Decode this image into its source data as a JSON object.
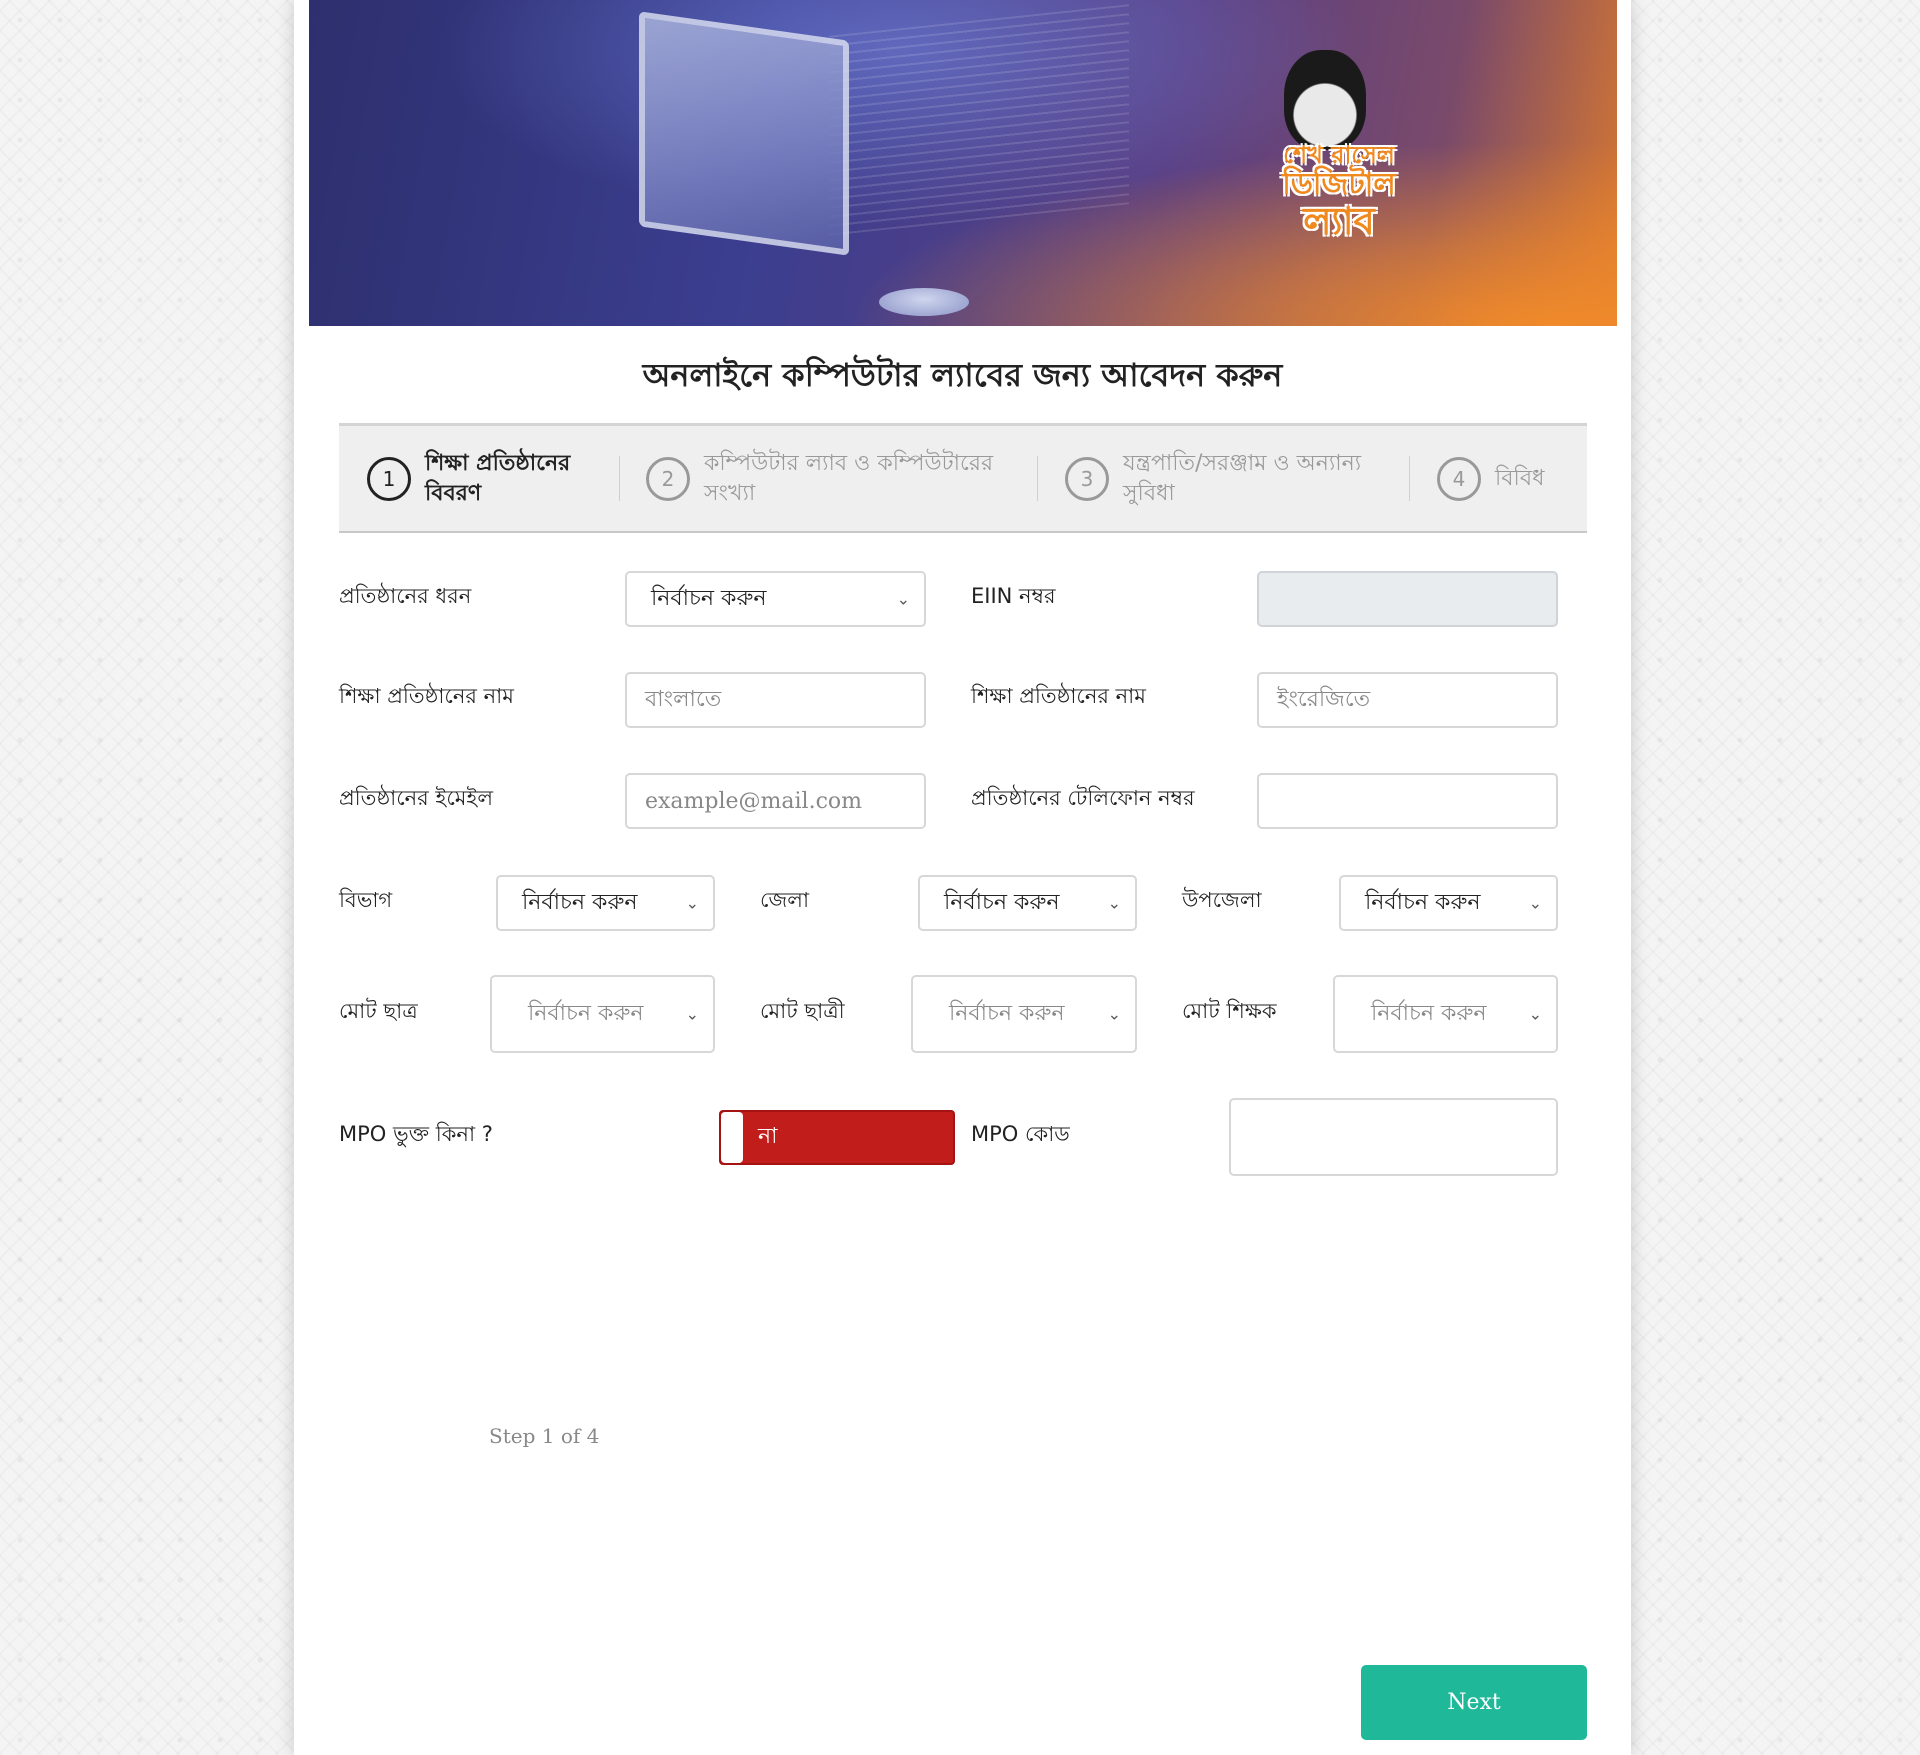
{
  "banner": {
    "logo_line1": "শেখ রাসেল",
    "logo_line2": "ডিজিটাল",
    "logo_line3": "ল্যাব"
  },
  "page_title": "অনলাইনে কম্পিউটার ল্যাবের জন্য আবেদন করুন",
  "steps": [
    {
      "number": "1",
      "label": "শিক্ষা প্রতিষ্ঠানের বিবরণ",
      "active": true
    },
    {
      "number": "2",
      "label": "কম্পিউটার ল্যাব ও কম্পিউটারের সংখ্যা",
      "active": false
    },
    {
      "number": "3",
      "label": "যন্ত্রপাতি/সরঞ্জাম ও অন্যান্য সুবিধা",
      "active": false
    },
    {
      "number": "4",
      "label": "বিবিধ",
      "active": false
    }
  ],
  "form": {
    "institution_type": {
      "label": "প্রতিষ্ঠানের ধরন",
      "value": "নির্বাচন করুন"
    },
    "eiin": {
      "label": "EIIN নম্বর",
      "value": ""
    },
    "name_bn": {
      "label": "শিক্ষা প্রতিষ্ঠানের নাম",
      "placeholder": "বাংলাতে"
    },
    "name_en": {
      "label": "শিক্ষা প্রতিষ্ঠানের নাম",
      "placeholder": "ইংরেজিতে"
    },
    "email": {
      "label": "প্রতিষ্ঠানের ইমেইল",
      "placeholder": "example@mail.com"
    },
    "phone": {
      "label": "প্রতিষ্ঠানের টেলিফোন নম্বর",
      "value": ""
    },
    "division": {
      "label": "বিভাগ",
      "value": "নির্বাচন করুন"
    },
    "district": {
      "label": "জেলা",
      "value": "নির্বাচন করুন"
    },
    "upazila": {
      "label": "উপজেলা",
      "value": "নির্বাচন করুন"
    },
    "total_male_students": {
      "label": "মোট ছাত্র",
      "value": "নির্বাচন করুন"
    },
    "total_female_students": {
      "label": "মোট ছাত্রী",
      "value": "নির্বাচন করুন"
    },
    "total_teachers": {
      "label": "মোট শিক্ষক",
      "value": "নির্বাচন করুন"
    },
    "mpo_included": {
      "label": "MPO ভুক্ত কিনা ?",
      "toggle_text": "না"
    },
    "mpo_code": {
      "label": "MPO কোড",
      "value": ""
    }
  },
  "step_count": "Step 1 of 4",
  "next_button": "Next",
  "colors": {
    "toggle_off": "#c11d1b",
    "next_button": "#1fb99a"
  }
}
